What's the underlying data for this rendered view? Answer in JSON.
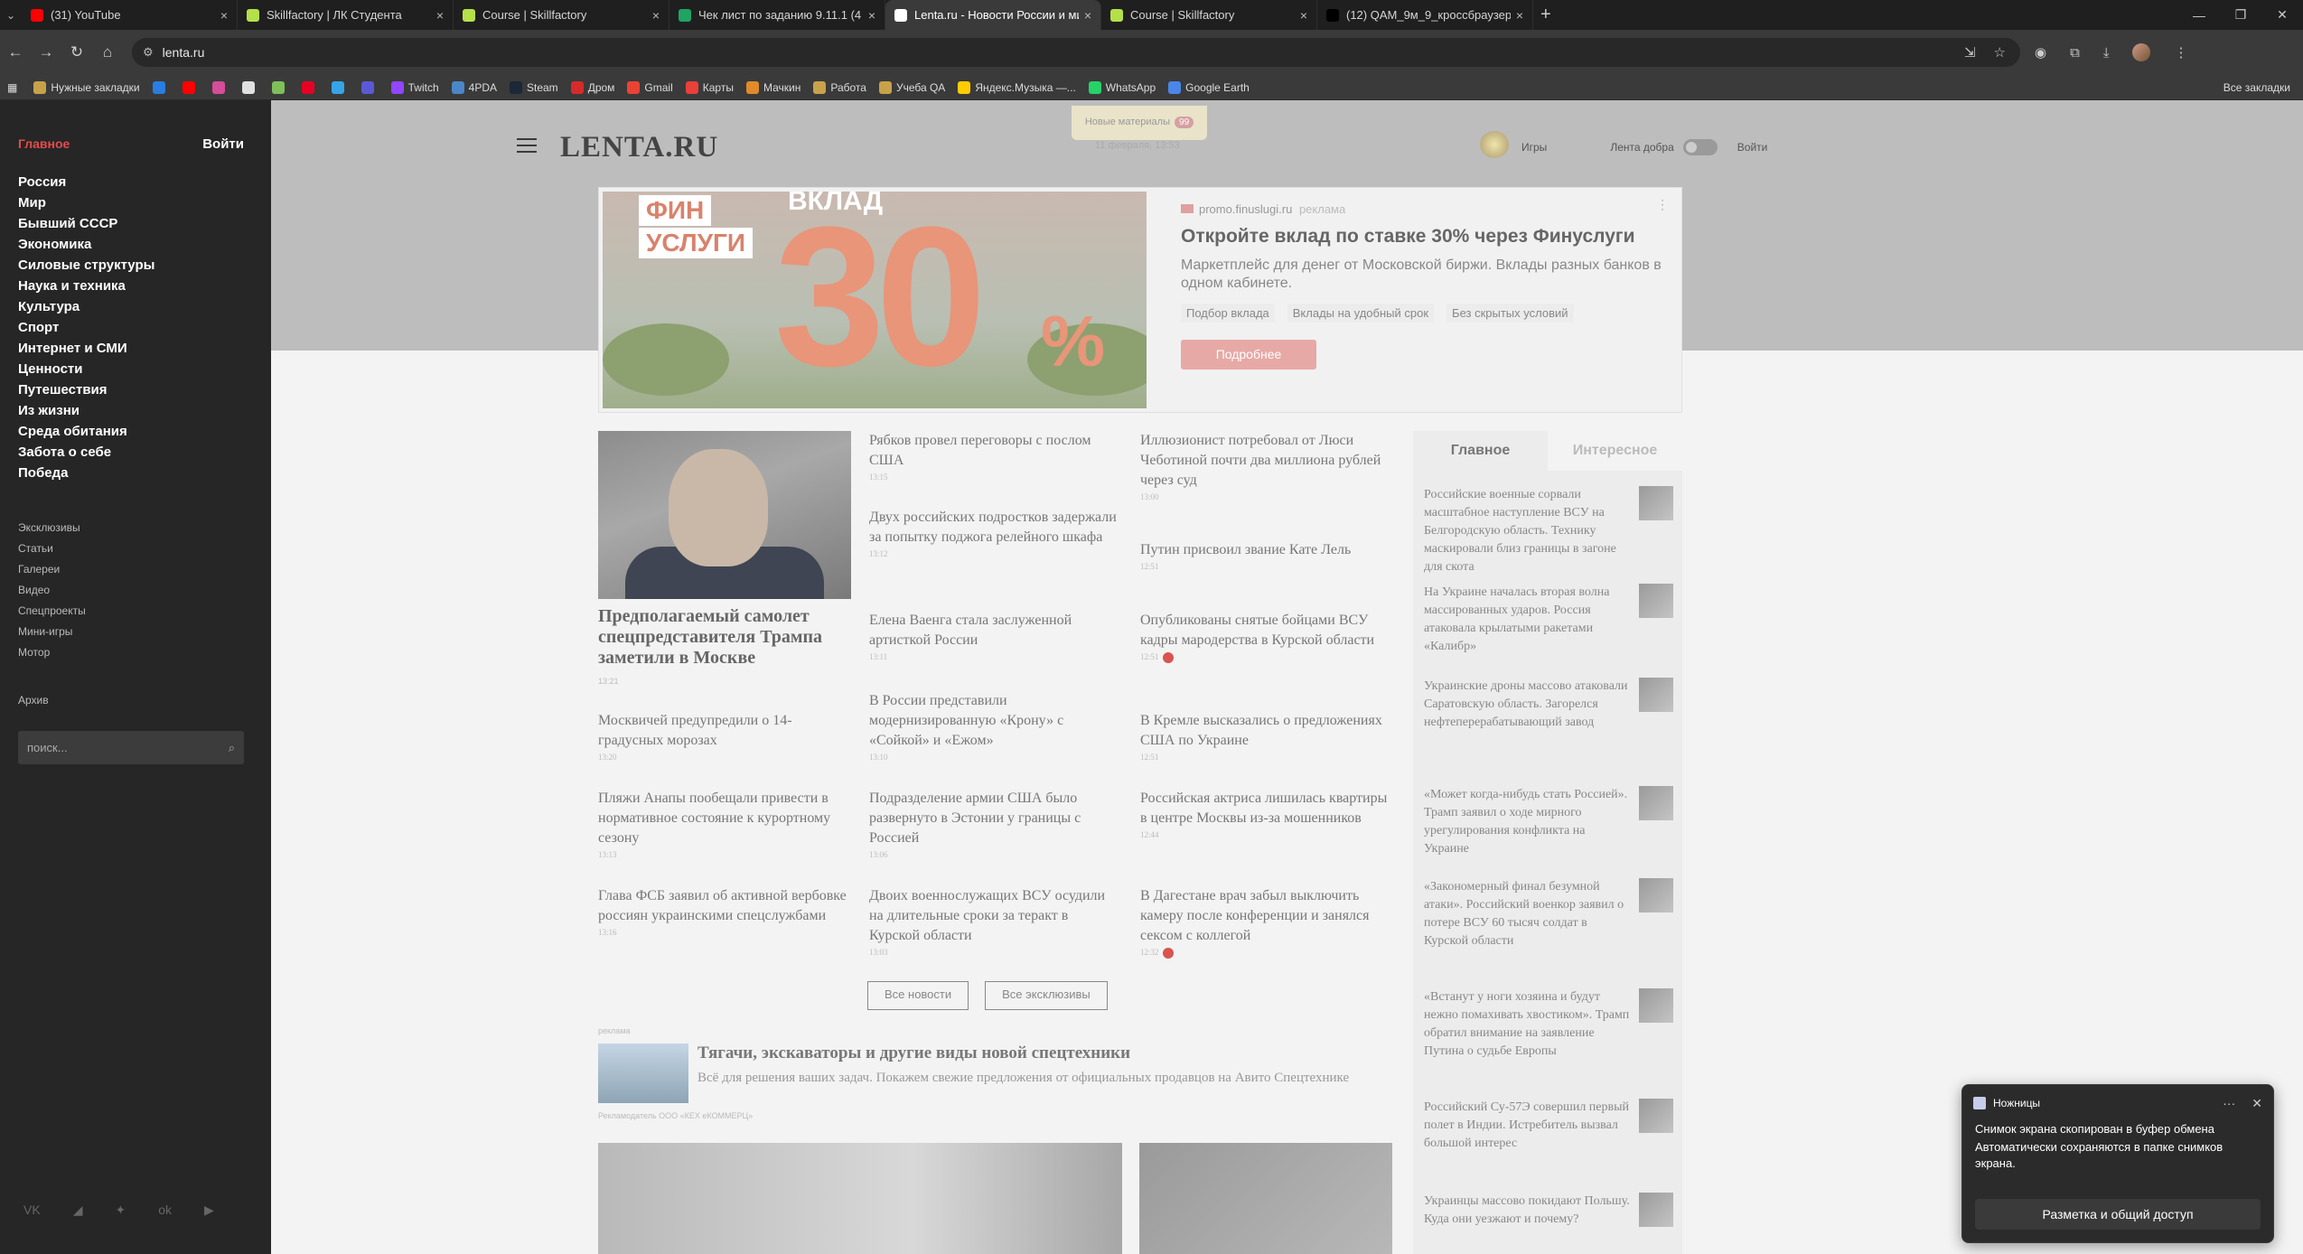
{
  "browser": {
    "tabs": [
      {
        "title": "(31) YouTube",
        "color": "#ff0000",
        "active": false
      },
      {
        "title": "Skillfactory | ЛК Студента",
        "color": "#b4e04a",
        "active": false
      },
      {
        "title": "Course | Skillfactory",
        "color": "#b4e04a",
        "active": false
      },
      {
        "title": "Чек лист по заданию 9.11.1 (4",
        "color": "#1fa463",
        "active": false
      },
      {
        "title": "Lenta.ru - Новости России и ми",
        "color": "#ffffff",
        "active": true
      },
      {
        "title": "Course | Skillfactory",
        "color": "#b4e04a",
        "active": false
      },
      {
        "title": "(12) QAM_9м_9_кроссбраузер",
        "color": "#000000",
        "active": false
      }
    ],
    "tab_close": "×",
    "tab_menu": "⌄",
    "new_tab": "+",
    "window_min": "—",
    "window_max": "❐",
    "window_close": "✕",
    "back": "←",
    "forward": "→",
    "reload": "↻",
    "home": "⌂",
    "url": "lenta.ru",
    "site_info_icon": "⚙",
    "bookmarks": [
      {
        "label": "Нужные закладки",
        "color": "#c8a24a"
      },
      {
        "label": "",
        "color": "#2a7de1"
      },
      {
        "label": "",
        "color": "#ff0000"
      },
      {
        "label": "",
        "color": "#d64d9a"
      },
      {
        "label": "",
        "color": "#e0e0e0"
      },
      {
        "label": "",
        "color": "#7fbf5a"
      },
      {
        "label": "",
        "color": "#e60023"
      },
      {
        "label": "",
        "color": "#36a4e8"
      },
      {
        "label": "",
        "color": "#5a5ad6"
      },
      {
        "label": "Twitch",
        "color": "#9146ff"
      },
      {
        "label": "4PDA",
        "color": "#4a86c8"
      },
      {
        "label": "Steam",
        "color": "#1b2838"
      },
      {
        "label": "Дром",
        "color": "#d62b2b"
      },
      {
        "label": "Gmail",
        "color": "#ea4335"
      },
      {
        "label": "Карты",
        "color": "#e8403a"
      },
      {
        "label": "Мачкин",
        "color": "#e08a2a"
      },
      {
        "label": "Работа",
        "color": "#c8a24a"
      },
      {
        "label": "Учеба QA",
        "color": "#c8a24a"
      },
      {
        "label": "Яндекс.Музыка —...",
        "color": "#ffcc00"
      },
      {
        "label": "WhatsApp",
        "color": "#25d366"
      },
      {
        "label": "Google Earth",
        "color": "#4a86e8"
      }
    ],
    "all_bookmarks": "Все закладки"
  },
  "sidebar": {
    "main": "Главное",
    "login": "Войти",
    "rubrics": [
      "Россия",
      "Мир",
      "Бывший СССР",
      "Экономика",
      "Силовые структуры",
      "Наука и техника",
      "Культура",
      "Спорт",
      "Интернет и СМИ",
      "Ценности",
      "Путешествия",
      "Из жизни",
      "Среда обитания",
      "Забота о себе",
      "Победа"
    ],
    "sections": [
      "Эксклюзивы",
      "Статьи",
      "Галереи",
      "Видео",
      "Спецпроекты",
      "Мини-игры",
      "Мотор"
    ],
    "archive": "Архив",
    "search_placeholder": "поиск...",
    "search_icon": "⌕",
    "social": [
      "VK",
      "◢",
      "✦",
      "ok",
      "▶"
    ]
  },
  "header": {
    "logo": "LENTA.RU",
    "new_materials": "Новые материалы",
    "new_count": "99",
    "date": "11 февраля, 13:53",
    "games": "Игры",
    "good_feed": "Лента добра",
    "login": "Войти"
  },
  "ad": {
    "img_fin": "ФИН",
    "img_usl": "УСЛУГИ",
    "img_vklad": "ВКЛАД",
    "img_big": "30",
    "img_pct": "%",
    "source": "promo.finuslugi.ru",
    "source_tag": "реклама",
    "title": "Откройте вклад по ставке 30% через Финуслуги",
    "desc": "Маркетплейс для денег от Московской биржи. Вклады разных банков в одном кабинете.",
    "chips": [
      "Подбор вклада",
      "Вклады на удобный срок",
      "Без скрытых условий"
    ],
    "button": "Подробнее",
    "more": "⋮"
  },
  "featured": {
    "title": "Предполагаемый самолет спецпредставителя Трампа заметили в Москве",
    "time": "13:21"
  },
  "news_col1": [
    {
      "t": "Москвичей предупредили о 14-градусных морозах",
      "tm": "13:20"
    },
    {
      "t": "Пляжи Анапы пообещали привести в нормативное состояние к курортному сезону",
      "tm": "13:13"
    },
    {
      "t": "Глава ФСБ заявил об активной вербовке россиян украинскими спецслужбами",
      "tm": "13:16"
    }
  ],
  "news_col2": [
    {
      "t": "Рябков провел переговоры с послом США",
      "tm": "13:15"
    },
    {
      "t": "Двух российских подростков задержали за попытку поджога релейного шкафа",
      "tm": "13:12"
    },
    {
      "t": "Елена Ваенга стала заслуженной артисткой России",
      "tm": "13:11"
    },
    {
      "t": "В России представили модернизированную «Крону» с «Сойкой» и «Ежом»",
      "tm": "13:10"
    },
    {
      "t": "Подразделение армии США было развернуто в Эстонии у границы с Россией",
      "tm": "13:06"
    },
    {
      "t": "Двоих военнослужащих ВСУ осудили на длительные сроки за теракт в Курской области",
      "tm": "13:03"
    }
  ],
  "news_col3": [
    {
      "t": "Иллюзионист потребовал от Люси Чеботиной почти два миллиона рублей через суд",
      "tm": "13:00"
    },
    {
      "t": "Путин присвоил звание Кате Лель",
      "tm": "12:51"
    },
    {
      "t": "Опубликованы снятые бойцами ВСУ кадры мародерства в Курской области",
      "tm": "12:51"
    },
    {
      "t": "В Кремле высказались о предложениях США по Украине",
      "tm": "12:51"
    },
    {
      "t": "Российская актриса лишилась квартиры в центре Москвы из-за мошенников",
      "tm": "12:44"
    },
    {
      "t": "В Дагестане врач забыл выключить камеру после конференции и занялся сексом с коллегой",
      "tm": "12:32"
    }
  ],
  "buttons": {
    "all_news": "Все новости",
    "all_exclusives": "Все эксклюзивы"
  },
  "promo": {
    "label": "реклама",
    "title": "Тягачи, экскаваторы и другие виды новой спецтехники",
    "desc": "Всё для решения ваших задач. Покажем свежие предложения от официальных продавцов на Авито Спецтехнике",
    "advertiser": "Рекламодатель ООО «КЕХ еКОММЕРЦ»"
  },
  "right_column": {
    "tab_main": "Главное",
    "tab_interesting": "Интересное",
    "items": [
      "Российские военные сорвали масштабное наступление ВСУ на Белгородскую область. Технику маскировали близ границы в загоне для скота",
      "На Украине началась вторая волна массированных ударов. Россия атаковала крылатыми ракетами «Калибр»",
      "Украинские дроны массово атаковали Саратовскую область. Загорелся нефтеперерабатывающий завод",
      "«Может когда-нибудь стать Россией». Трамп заявил о ходе мирного урегулирования конфликта на Украине",
      "«Закономерный финал безумной атаки». Российский военкор заявил о потере ВСУ 60 тысяч солдат в Курской области",
      "«Встанут у ноги хозяина и будут нежно помахивать хвостиком». Трамп обратил внимание на заявление Путина о судьбе Европы",
      "Российский Су-57Э совершил первый полет в Индии. Истребитель вызвал большой интерес",
      "Украинцы массово покидают Польшу. Куда они уезжают и почему?"
    ]
  },
  "toast": {
    "app": "Ножницы",
    "dots": "···",
    "close": "✕",
    "line1": "Снимок экрана скопирован в буфер обмена",
    "line2": "Автоматически сохраняются в папке снимков экрана.",
    "button": "Разметка и общий доступ"
  }
}
